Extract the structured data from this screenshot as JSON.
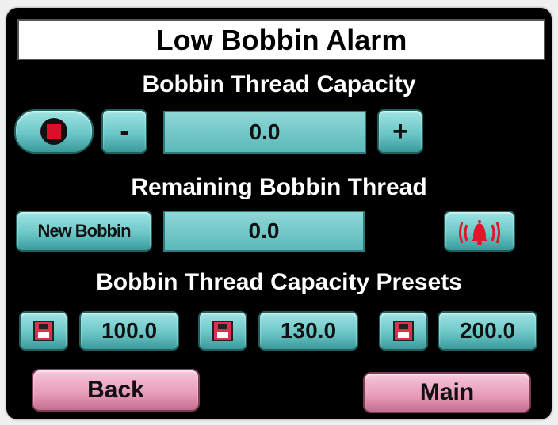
{
  "title": "Low Bobbin Alarm",
  "capacity": {
    "heading": "Bobbin Thread Capacity",
    "minus_label": "-",
    "plus_label": "+",
    "value": "0.0"
  },
  "remaining": {
    "heading": "Remaining Bobbin Thread",
    "new_bobbin_label": "New Bobbin",
    "value": "0.0",
    "alarm_icon": "bell-alarm-icon"
  },
  "presets": {
    "heading": "Bobbin Thread Capacity Presets",
    "items": [
      {
        "value": "100.0",
        "icon": "floppy-save-icon"
      },
      {
        "value": "130.0",
        "icon": "floppy-save-icon"
      },
      {
        "value": "200.0",
        "icon": "floppy-save-icon"
      }
    ]
  },
  "nav": {
    "back_label": "Back",
    "main_label": "Main"
  },
  "colors": {
    "button": "#6cc7c7",
    "nav_button": "#e79ab7",
    "alarm": "#e0162b",
    "stop": "#d8102a"
  }
}
